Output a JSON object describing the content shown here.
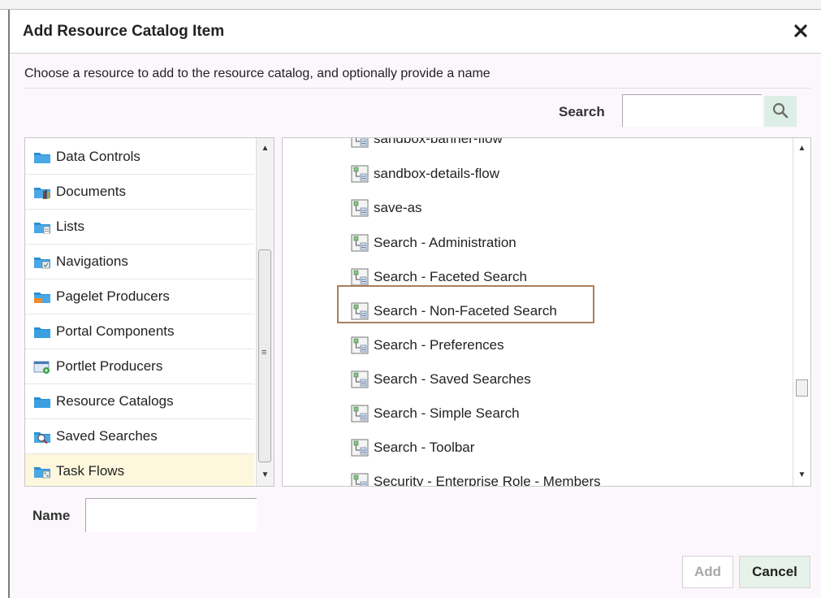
{
  "dialog": {
    "title": "Add Resource Catalog Item",
    "close_label": "✕",
    "instruction": "Choose a resource to add to the resource catalog, and optionally provide a name",
    "search_label": "Search",
    "search_value": "",
    "name_label": "Name",
    "name_value": "",
    "add_label": "Add",
    "cancel_label": "Cancel"
  },
  "left_list": {
    "items": [
      {
        "label": "Data Controls",
        "icon": "data-controls-folder-icon"
      },
      {
        "label": "Documents",
        "icon": "documents-folder-icon"
      },
      {
        "label": "Lists",
        "icon": "lists-folder-icon"
      },
      {
        "label": "Navigations",
        "icon": "navigations-folder-icon"
      },
      {
        "label": "Pagelet Producers",
        "icon": "pagelet-producers-folder-icon"
      },
      {
        "label": "Portal Components",
        "icon": "folder-icon"
      },
      {
        "label": "Portlet Producers",
        "icon": "portlet-producers-icon"
      },
      {
        "label": "Resource Catalogs",
        "icon": "folder-icon"
      },
      {
        "label": "Saved Searches",
        "icon": "saved-searches-icon"
      },
      {
        "label": "Task Flows",
        "icon": "task-flows-folder-icon",
        "selected": true
      }
    ]
  },
  "right_list": {
    "items": [
      {
        "label": "sandbox-banner-flow"
      },
      {
        "label": "sandbox-details-flow"
      },
      {
        "label": "save-as"
      },
      {
        "label": "Search - Administration"
      },
      {
        "label": "Search - Faceted Search"
      },
      {
        "label": "Search - Non-Faceted Search",
        "highlighted": true
      },
      {
        "label": "Search - Preferences"
      },
      {
        "label": "Search - Saved Searches"
      },
      {
        "label": "Search - Simple Search"
      },
      {
        "label": "Search - Toolbar"
      },
      {
        "label": "Security - Enterprise Role - Members"
      }
    ]
  },
  "colors": {
    "dialog_bg": "#fcf7fc",
    "selected_row": "#fdf7dd",
    "highlight_border": "#a97f5d",
    "cancel_bg": "#e6f2ea",
    "folder_blue": "#2a8fd0"
  }
}
